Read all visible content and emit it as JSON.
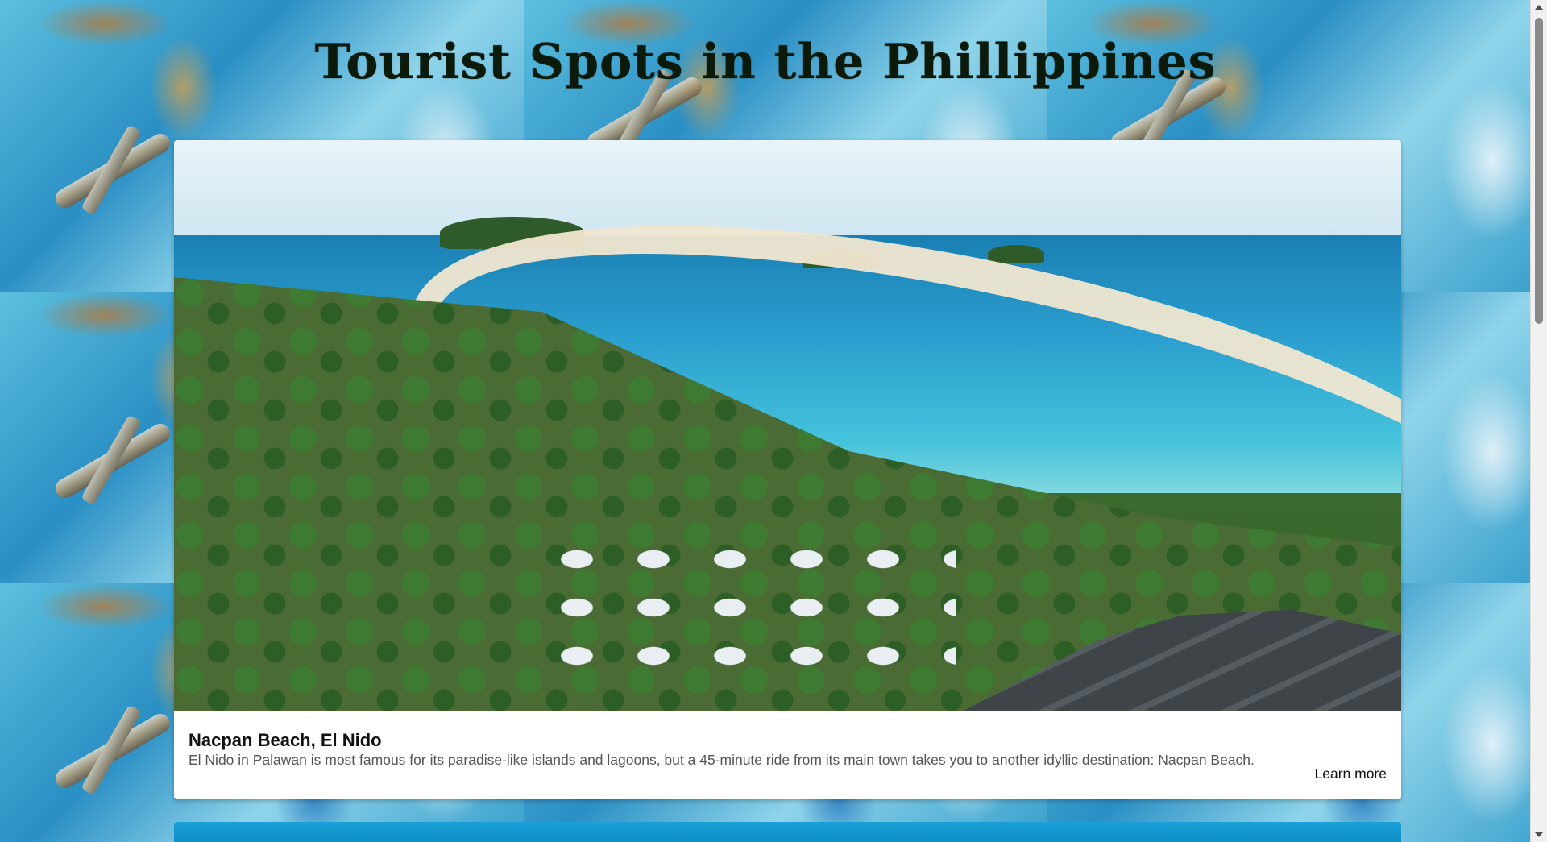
{
  "page": {
    "title": "Tourist Spots in the Phillippines"
  },
  "card": {
    "image_alt": "Nacpan Beach, El Nido",
    "title": "Nacpan Beach, El Nido",
    "text": "El Nido in Palawan is most famous for its paradise-like islands and lagoons, but a 45-minute ride from its main town takes you to another idyllic destination: Nacpan Beach.",
    "link_label": "Learn more"
  },
  "icons": {
    "scroll_up": "triangle-up-icon",
    "scroll_down": "triangle-down-icon"
  },
  "colors": {
    "title": "#0b1a0a",
    "card_bg": "#ffffff",
    "card_text": "#555555"
  }
}
